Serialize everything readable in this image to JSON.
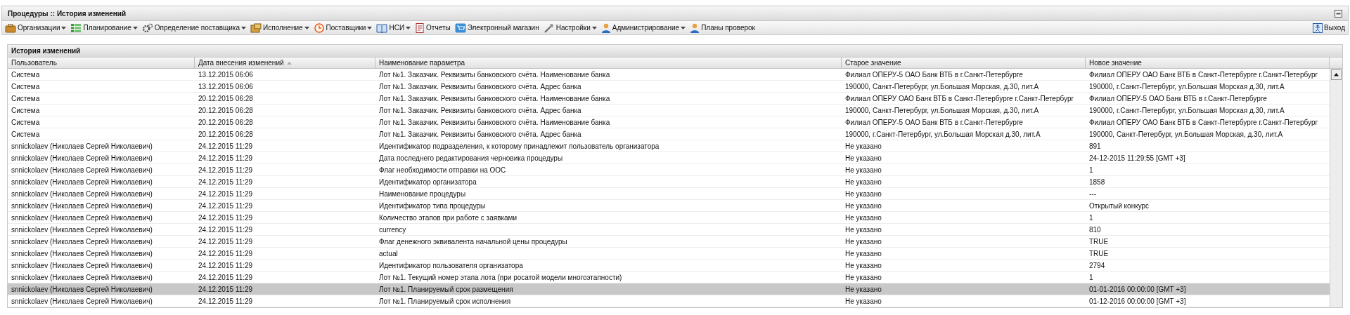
{
  "window": {
    "title": "Процедуры :: История изменений"
  },
  "toolbar": {
    "items": [
      {
        "label": "Организации",
        "dropdown": true
      },
      {
        "label": "Планирование",
        "dropdown": true
      },
      {
        "label": "Определение поставщика",
        "dropdown": true
      },
      {
        "label": "Исполнение",
        "dropdown": true
      },
      {
        "label": "Поставщики",
        "dropdown": true
      },
      {
        "label": "НСИ",
        "dropdown": true
      },
      {
        "label": "Отчеты",
        "dropdown": false
      },
      {
        "label": "Электронный магазин",
        "dropdown": false
      },
      {
        "label": "Настройки",
        "dropdown": true
      },
      {
        "label": "Администрирование",
        "dropdown": true
      },
      {
        "label": "Планы проверок",
        "dropdown": false
      }
    ],
    "exit": "Выход"
  },
  "panel": {
    "title": "История изменений"
  },
  "table": {
    "columns": [
      {
        "label": "Пользователь",
        "sorted": false
      },
      {
        "label": "Дата внесения изменений",
        "sorted": true
      },
      {
        "label": "Наименование параметра",
        "sorted": false
      },
      {
        "label": "Старое значение",
        "sorted": false
      },
      {
        "label": "Новое значение",
        "sorted": false
      }
    ],
    "rows": [
      {
        "selected": false,
        "cells": [
          "Система",
          "13.12.2015 06:06",
          "Лот №1. Заказчик. Реквизиты банковского счёта. Наименование банка",
          "Филиал ОПЕРУ-5 ОАО Банк ВТБ в г.Санкт-Петербурге",
          "Филиал ОПЕРУ ОАО Банк ВТБ в Санкт-Петербурге г.Санкт-Петербург"
        ]
      },
      {
        "selected": false,
        "cells": [
          "Система",
          "13.12.2015 06:06",
          "Лот №1. Заказчик. Реквизиты банковского счёта. Адрес банка",
          "190000, Санкт-Петербург, ул.Большая Морская, д.30, лит.А",
          "190000, г.Санкт-Петербург, ул.Большая Морская д.30, лит.А"
        ]
      },
      {
        "selected": false,
        "cells": [
          "Система",
          "20.12.2015 06:28",
          "Лот №1. Заказчик. Реквизиты банковского счёта. Наименование банка",
          "Филиал ОПЕРУ ОАО Банк ВТБ в Санкт-Петербурге г.Санкт-Петербург",
          "Филиал ОПЕРУ-5 ОАО Банк ВТБ в г.Санкт-Петербурге"
        ]
      },
      {
        "selected": false,
        "cells": [
          "Система",
          "20.12.2015 06:28",
          "Лот №1. Заказчик. Реквизиты банковского счёта. Адрес банка",
          "190000, Санкт-Петербург, ул.Большая Морская, д.30, лит.А",
          "190000, г.Санкт-Петербург, ул.Большая Морская д.30, лит.А"
        ]
      },
      {
        "selected": false,
        "cells": [
          "Система",
          "20.12.2015 06:28",
          "Лот №1. Заказчик. Реквизиты банковского счёта. Наименование банка",
          "Филиал ОПЕРУ-5 ОАО Банк ВТБ в г.Санкт-Петербурге",
          "Филиал ОПЕРУ ОАО Банк ВТБ в Санкт-Петербурге г.Санкт-Петербург"
        ]
      },
      {
        "selected": false,
        "cells": [
          "Система",
          "20.12.2015 06:28",
          "Лот №1. Заказчик. Реквизиты банковского счёта. Адрес банка",
          "190000, г.Санкт-Петербург, ул.Большая Морская д.30, лит.А",
          "190000, Санкт-Петербург, ул.Большая Морская, д.30, лит.А"
        ]
      },
      {
        "selected": false,
        "cells": [
          "snnickolaev (Николаев Сергей Николаевич)",
          "24.12.2015 11:29",
          "Идентификатор подразделения, к которому принадлежит пользователь организатора",
          "Не указано",
          "891"
        ]
      },
      {
        "selected": false,
        "cells": [
          "snnickolaev (Николаев Сергей Николаевич)",
          "24.12.2015 11:29",
          "Дата последнего редактирования черновика процедуры",
          "Не указано",
          "24-12-2015 11:29:55 [GMT +3]"
        ]
      },
      {
        "selected": false,
        "cells": [
          "snnickolaev (Николаев Сергей Николаевич)",
          "24.12.2015 11:29",
          "Флаг необходимости отправки на ООС",
          "Не указано",
          "1"
        ]
      },
      {
        "selected": false,
        "cells": [
          "snnickolaev (Николаев Сергей Николаевич)",
          "24.12.2015 11:29",
          "Идентификатор организатора",
          "Не указано",
          "1858"
        ]
      },
      {
        "selected": false,
        "cells": [
          "snnickolaev (Николаев Сергей Николаевич)",
          "24.12.2015 11:29",
          "Наименование процедуры",
          "Не указано",
          "---"
        ]
      },
      {
        "selected": false,
        "cells": [
          "snnickolaev (Николаев Сергей Николаевич)",
          "24.12.2015 11:29",
          "Идентификатор типа процедуры",
          "Не указано",
          "Открытый конкурс"
        ]
      },
      {
        "selected": false,
        "cells": [
          "snnickolaev (Николаев Сергей Николаевич)",
          "24.12.2015 11:29",
          "Количество этапов при работе с заявками",
          "Не указано",
          "1"
        ]
      },
      {
        "selected": false,
        "cells": [
          "snnickolaev (Николаев Сергей Николаевич)",
          "24.12.2015 11:29",
          "currency",
          "Не указано",
          "810"
        ]
      },
      {
        "selected": false,
        "cells": [
          "snnickolaev (Николаев Сергей Николаевич)",
          "24.12.2015 11:29",
          "Флаг денежного эквивалента начальной цены процедуры",
          "Не указано",
          "TRUE"
        ]
      },
      {
        "selected": false,
        "cells": [
          "snnickolaev (Николаев Сергей Николаевич)",
          "24.12.2015 11:29",
          "actual",
          "Не указано",
          "TRUE"
        ]
      },
      {
        "selected": false,
        "cells": [
          "snnickolaev (Николаев Сергей Николаевич)",
          "24.12.2015 11:29",
          "Идентификатор пользователя организатора",
          "Не указано",
          "2794"
        ]
      },
      {
        "selected": false,
        "cells": [
          "snnickolaev (Николаев Сергей Николаевич)",
          "24.12.2015 11:29",
          "Лот №1. Текущий номер этапа лота (при росатой модели многоэтапности)",
          "Не указано",
          "1"
        ]
      },
      {
        "selected": true,
        "cells": [
          "snnickolaev (Николаев Сергей Николаевич)",
          "24.12.2015 11:29",
          "Лот №1. Планируемый срок размещения",
          "Не указано",
          "01-01-2016 00:00:00 [GMT +3]"
        ]
      },
      {
        "selected": false,
        "cells": [
          "snnickolaev (Николаев Сергей Николаевич)",
          "24.12.2015 11:29",
          "Лот №1. Планируемый срок исполнения",
          "Не указано",
          "01-12-2016 00:00:00 [GMT +3]"
        ]
      }
    ]
  }
}
